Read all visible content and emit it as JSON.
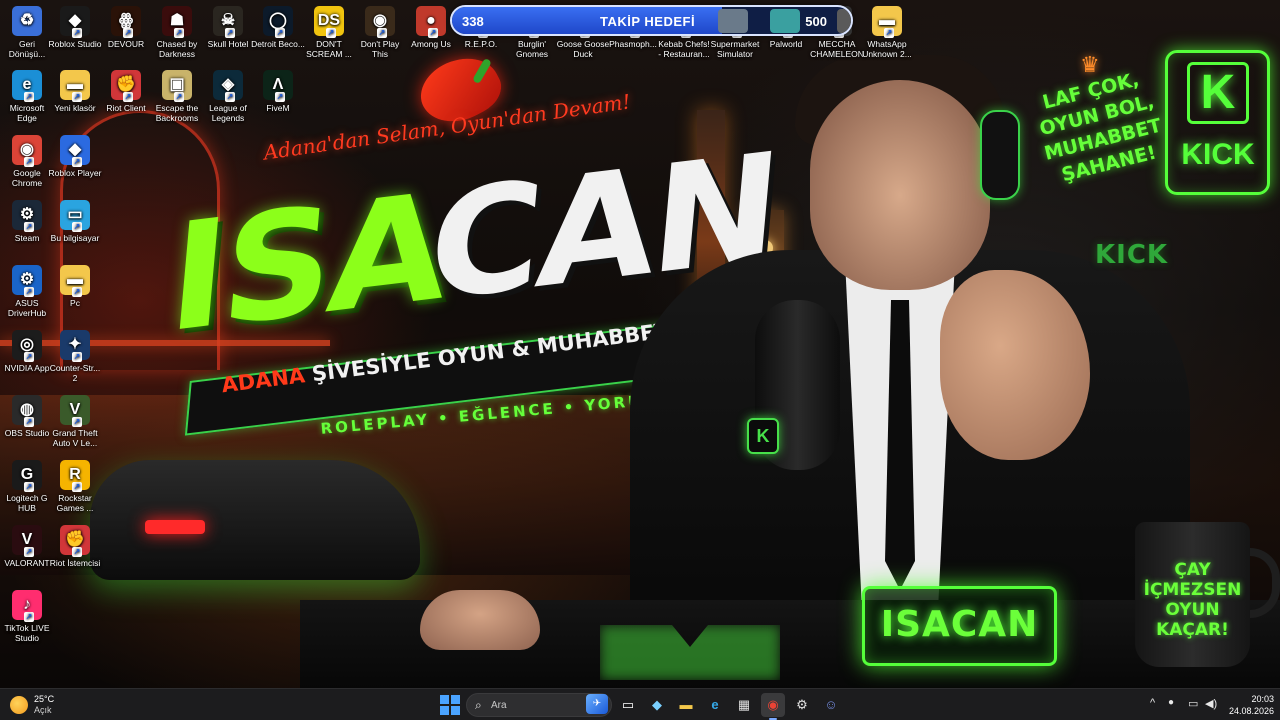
{
  "desktop": {
    "icons": [
      {
        "label": "Geri Dönüşü...",
        "icon": "recycle-bin-icon",
        "color": "#3a6fd8",
        "glyph": "♻"
      },
      {
        "label": "Roblox Studio",
        "icon": "roblox-studio-icon",
        "color": "#1a1a1a",
        "glyph": "◆"
      },
      {
        "label": "DEVOUR",
        "icon": "devour-icon",
        "color": "#2a1208",
        "glyph": "ꙮ"
      },
      {
        "label": "Chased by Darkness",
        "icon": "chased-by-darkness-icon",
        "color": "#3a0c0c",
        "glyph": "☗"
      },
      {
        "label": "Skull Hotel",
        "icon": "skull-hotel-icon",
        "color": "#2a2620",
        "glyph": "☠"
      },
      {
        "label": "Detroit Beco...",
        "icon": "detroit-icon",
        "color": "#0c1a2a",
        "glyph": "◯"
      },
      {
        "label": "DON'T SCREAM ...",
        "icon": "dont-scream-icon",
        "color": "#f1c40f",
        "glyph": "DS"
      },
      {
        "label": "Don't Play This",
        "icon": "dont-play-this-icon",
        "color": "#3a2a1a",
        "glyph": "◉"
      },
      {
        "label": "Among Us",
        "icon": "among-us-icon",
        "color": "#c0392b",
        "glyph": "●"
      },
      {
        "label": "R.E.P.O.",
        "icon": "repo-icon",
        "color": "#1a1a1a",
        "glyph": "▦"
      },
      {
        "label": "Burglin' Gnomes",
        "icon": "burglin-gnomes-icon",
        "color": "#2a1a3a",
        "glyph": "♠"
      },
      {
        "label": "Goose Goose Duck",
        "icon": "goose-goose-duck-icon",
        "color": "#3a2a10",
        "glyph": "◒"
      },
      {
        "label": "Phasmoph...",
        "icon": "phasmophobia-icon",
        "color": "#1a2a2a",
        "glyph": "✶"
      },
      {
        "label": "Kebab Chefs! - Restauran...",
        "icon": "kebab-chefs-icon",
        "color": "#5a2a10",
        "glyph": "⚑"
      },
      {
        "label": "Supermarket Simulator",
        "icon": "supermarket-simulator-icon",
        "color": "#1a3a5a",
        "glyph": "▤"
      },
      {
        "label": "Palworld",
        "icon": "palworld-icon",
        "color": "#2a5a7a",
        "glyph": "✿"
      },
      {
        "label": "MECCHA CHAMELEON",
        "icon": "meccha-chameleon-icon",
        "color": "#3a3a3a",
        "glyph": "❀"
      },
      {
        "label": "WhatsApp Unknown 2...",
        "icon": "folder-icon",
        "color": "#f3c74b",
        "glyph": "▬"
      },
      {
        "label": "Microsoft Edge",
        "icon": "edge-icon",
        "color": "#1b8fd6",
        "glyph": "e"
      },
      {
        "label": "Yeni klasör",
        "icon": "folder-icon",
        "color": "#f3c74b",
        "glyph": "▬"
      },
      {
        "label": "Riot Client",
        "icon": "riot-client-icon",
        "color": "#d13639",
        "glyph": "✊"
      },
      {
        "label": "Escape the Backrooms",
        "icon": "escape-backrooms-icon",
        "color": "#c9b36a",
        "glyph": "▣"
      },
      {
        "label": "League of Legends",
        "icon": "league-of-legends-icon",
        "color": "#0c2a3a",
        "glyph": "◈"
      },
      {
        "label": "FiveM",
        "icon": "fivem-icon",
        "color": "#0c2418",
        "glyph": "Λ"
      },
      {
        "label": "Google Chrome",
        "icon": "chrome-icon",
        "color": "#db4437",
        "glyph": "◉"
      },
      {
        "label": "Roblox Player",
        "icon": "roblox-player-icon",
        "color": "#2b6ae0",
        "glyph": "◆"
      },
      {
        "label": "Steam",
        "icon": "steam-icon",
        "color": "#1b2838",
        "glyph": "⚙"
      },
      {
        "label": "Bu bilgisayar",
        "icon": "this-pc-icon",
        "color": "#2aa4e0",
        "glyph": "▭"
      },
      {
        "label": "ASUS DriverHub",
        "icon": "asus-driverhub-icon",
        "color": "#1a64c8",
        "glyph": "⚙"
      },
      {
        "label": "Pc",
        "icon": "folder-icon",
        "color": "#f3c74b",
        "glyph": "▬"
      },
      {
        "label": "NVIDIA App",
        "icon": "nvidia-icon",
        "color": "#1c1c1c",
        "glyph": "◎"
      },
      {
        "label": "Counter-Str... 2",
        "icon": "counter-strike-icon",
        "color": "#1a3a6a",
        "glyph": "✦"
      },
      {
        "label": "OBS Studio",
        "icon": "obs-icon",
        "color": "#2a2a2a",
        "glyph": "◍"
      },
      {
        "label": "Grand Theft Auto V Le...",
        "icon": "gta-v-icon",
        "color": "#3a5a2a",
        "glyph": "V"
      },
      {
        "label": "Logitech G HUB",
        "icon": "logitech-g-hub-icon",
        "color": "#1a1a1a",
        "glyph": "G"
      },
      {
        "label": "Rockstar Games ...",
        "icon": "rockstar-icon",
        "color": "#f5b400",
        "glyph": "R"
      },
      {
        "label": "VALORANT",
        "icon": "valorant-icon",
        "color": "#2a0c10",
        "glyph": "V"
      },
      {
        "label": "Riot İstemcisi",
        "icon": "riot-client-icon",
        "color": "#d13639",
        "glyph": "✊"
      },
      {
        "label": "TikTok LIVE Studio",
        "icon": "tiktok-live-icon",
        "color": "#ff2d6f",
        "glyph": "♪"
      }
    ]
  },
  "goal": {
    "current": "338",
    "label": "TAKİP HEDEFİ",
    "target": "500",
    "progress_fraction": 0.676
  },
  "wallpaper": {
    "tagline_top": "Adana'dan Selam, Oyun'dan Devam!",
    "logo_part1": "ISA",
    "logo_part2": "CAN",
    "banner_word1": "ADANA",
    "banner_word2": "ŞİVESİYLE OYUN & MUHABBET",
    "banner_sub": "ROLEPLAY • EĞLENCE • YORUM",
    "slogan_lines": [
      "LAF ÇOK,",
      "OYUN BOL,",
      "MUHABBET",
      "ŞAHANE!"
    ],
    "kick_logo_letter": "K",
    "kick_logo_word": "KICK",
    "chair_text": "KICK",
    "mic_badge": "K",
    "nameplate": "ISACAN",
    "mug_lines": [
      "ÇAY",
      "İÇMEZSEN",
      "OYUN",
      "KAÇAR!"
    ],
    "accent_green": "#66ff3a",
    "accent_red": "#ff3a1a"
  },
  "taskbar": {
    "weather": {
      "temp": "25°C",
      "desc": "Açık"
    },
    "search_placeholder": "Ara",
    "apps": [
      {
        "name": "start-button",
        "glyph": "⊞"
      },
      {
        "name": "widgets-button",
        "glyph": "✈"
      },
      {
        "name": "task-view-button",
        "glyph": "▭"
      },
      {
        "name": "copilot-button",
        "glyph": "◆"
      },
      {
        "name": "file-explorer-button",
        "glyph": "▬"
      },
      {
        "name": "edge-button",
        "glyph": "e"
      },
      {
        "name": "store-button",
        "glyph": "▦"
      },
      {
        "name": "chrome-button",
        "glyph": "◉"
      },
      {
        "name": "steam-button",
        "glyph": "⚙"
      },
      {
        "name": "discord-button",
        "glyph": "☺"
      }
    ],
    "tray": {
      "chevron": "^",
      "mic": "🎤",
      "monitor": "▭",
      "volume": "🔊"
    },
    "time": "20:03",
    "date": "24.08.2026"
  }
}
